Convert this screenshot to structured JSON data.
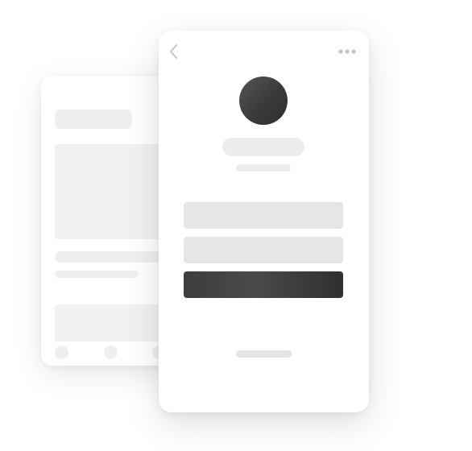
{
  "colors": {
    "background": "#ffffff",
    "card": "#ffffff",
    "placeholder": "#ececec",
    "field": "#e6e6e6",
    "dark": "#3d3d3d",
    "icon": "#c4c4c4"
  },
  "front_card": {
    "back_icon": "chevron-left-icon",
    "menu_icon": "more-horizontal-icon"
  }
}
